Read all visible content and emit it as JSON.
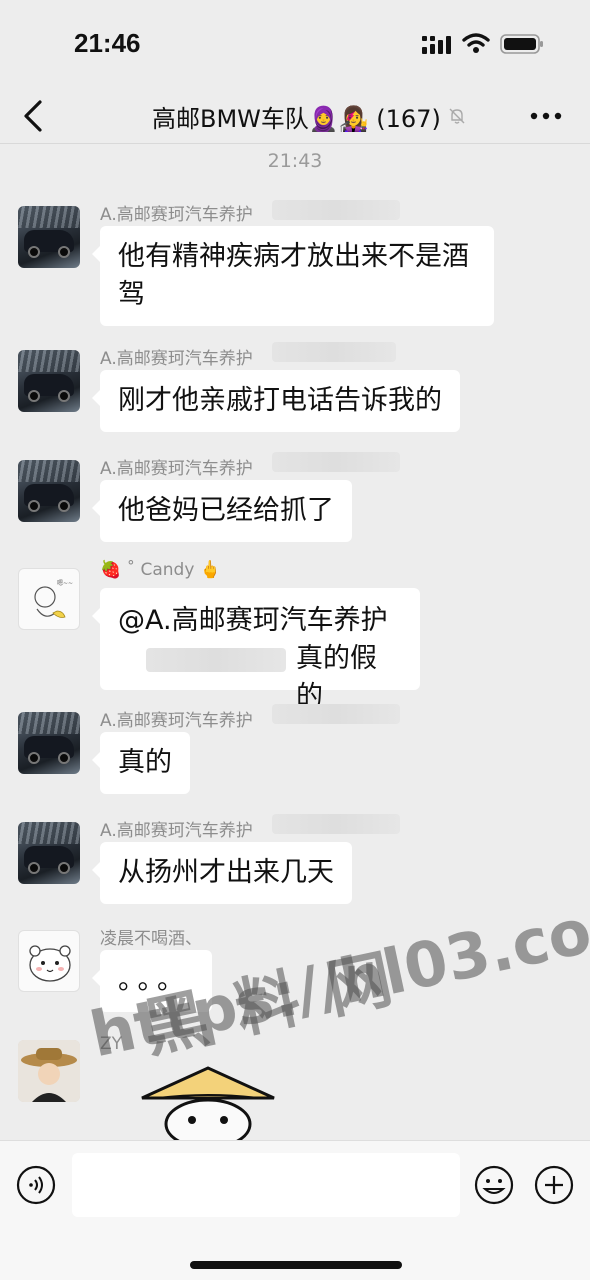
{
  "status_bar": {
    "time": "21:46"
  },
  "nav": {
    "title": "高邮BMW车队🧕👩‍🎤 (167)"
  },
  "chat": {
    "timestamp": "21:43",
    "messages": [
      {
        "sender": "A.高邮赛珂汽车养护",
        "text_lines": [
          "他有精神疾病才放出来不是酒",
          "驾"
        ],
        "avatar": "car-avatar"
      },
      {
        "sender": "A.高邮赛珂汽车养护",
        "text_lines": [
          "刚才他亲戚打电话告诉我的"
        ],
        "avatar": "car-avatar"
      },
      {
        "sender": "A.高邮赛珂汽车养护",
        "text_lines": [
          "他爸妈已经给抓了"
        ],
        "avatar": "car-avatar"
      },
      {
        "sender": "🍓 ˚ Candy 🖕",
        "text_lines": [
          "@A.高邮赛珂汽车养护",
          "真的假的"
        ],
        "avatar": "cartoon-avatar"
      },
      {
        "sender": "A.高邮赛珂汽车养护",
        "text_lines": [
          "真的"
        ],
        "avatar": "car-avatar"
      },
      {
        "sender": "A.高邮赛珂汽车养护",
        "text_lines": [
          "从扬州才出来几天"
        ],
        "avatar": "car-avatar"
      },
      {
        "sender": "凌晨不喝酒、",
        "text_lines": [
          "。。。"
        ],
        "avatar": "bear-avatar"
      },
      {
        "sender": "ZY",
        "text_lines": [],
        "avatar": "hat-avatar"
      }
    ]
  },
  "watermark": {
    "top": "黑料网",
    "url": "https://hl03.co"
  },
  "icons": {
    "back": "chevron-left-icon",
    "mute": "bell-mute-icon",
    "more": "more-dots-icon",
    "voice": "voice-icon",
    "emoji": "emoji-icon",
    "plus": "plus-icon"
  },
  "colors": {
    "background": "#ededed",
    "bubble": "#ffffff",
    "sender_text": "#8d8d8d"
  }
}
